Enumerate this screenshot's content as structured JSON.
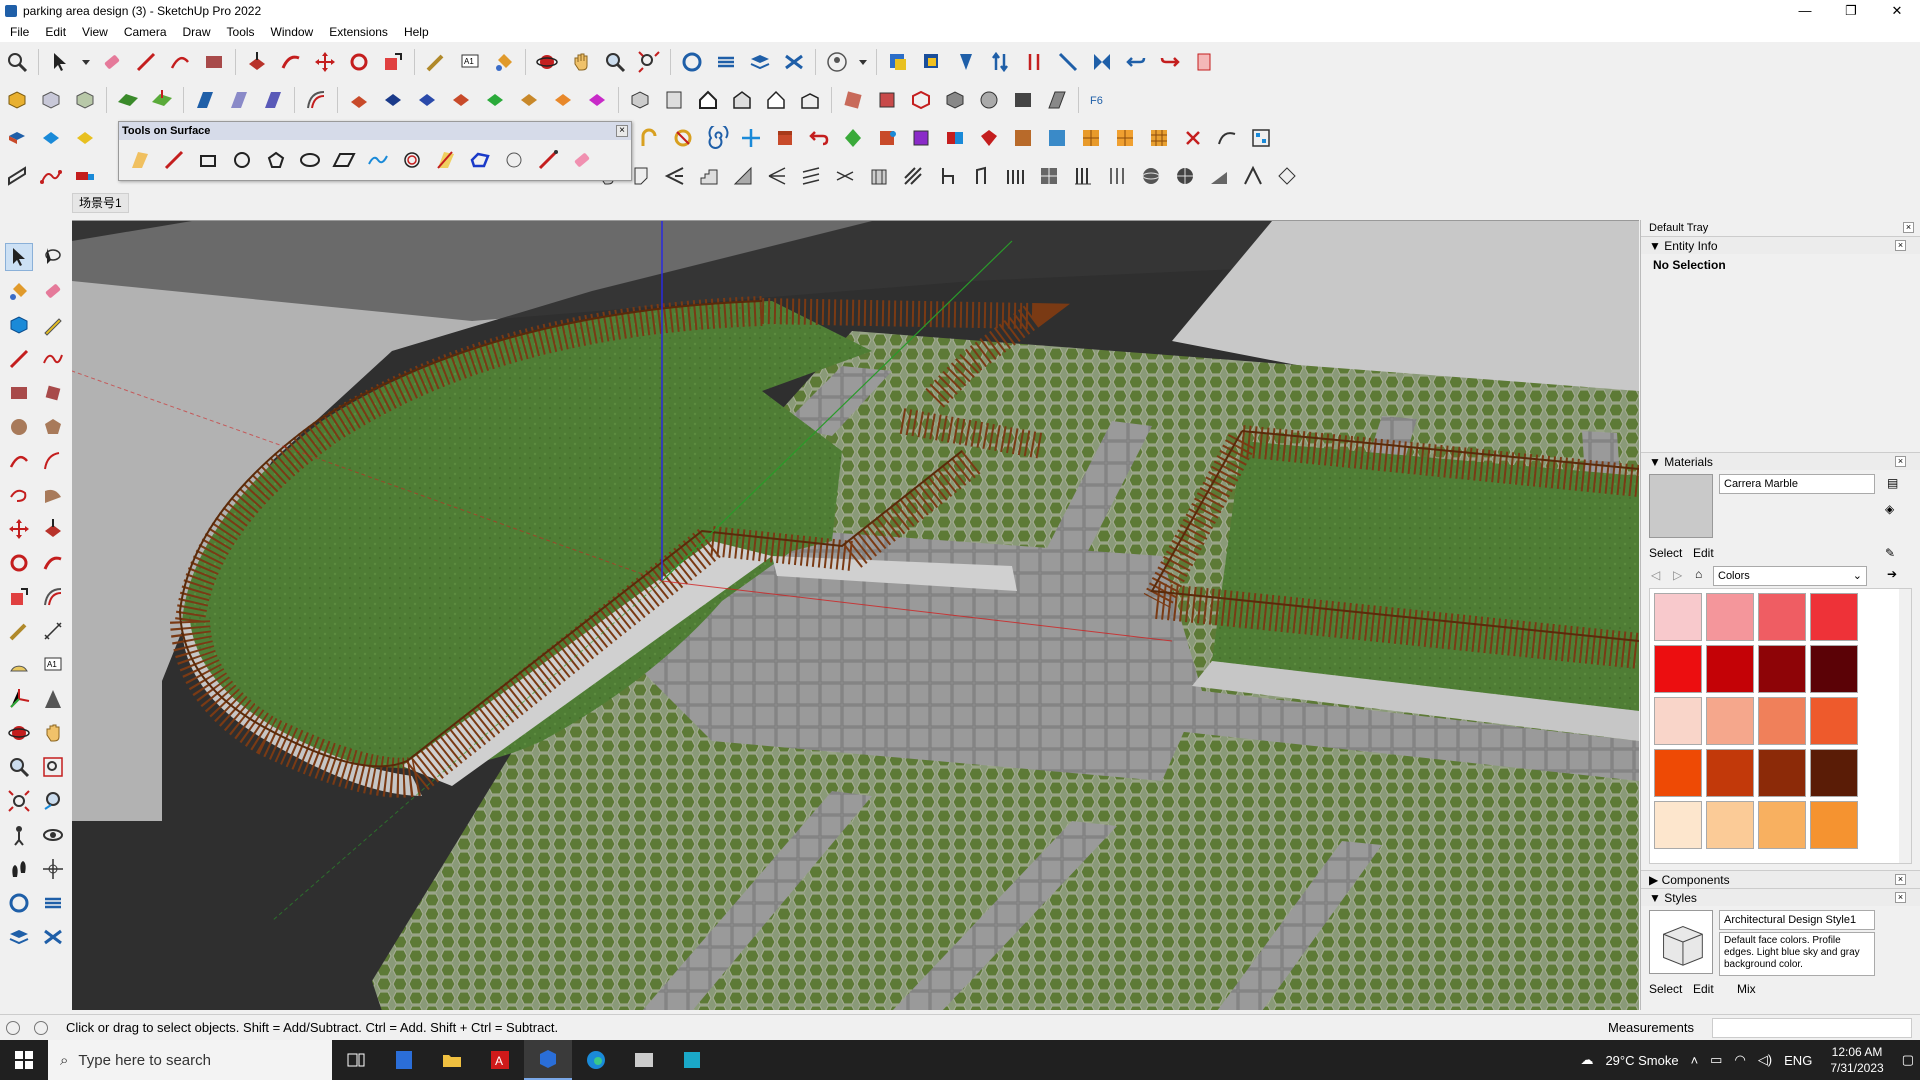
{
  "window": {
    "title": "parking area design (3) - SketchUp Pro 2022",
    "controls": [
      "—",
      "❐",
      "✕"
    ]
  },
  "menu": [
    "File",
    "Edit",
    "View",
    "Camera",
    "Draw",
    "Tools",
    "Window",
    "Extensions",
    "Help"
  ],
  "floating_toolbar": {
    "title": "Tools on Surface",
    "close": "×"
  },
  "scene_tab": "场景号1",
  "tray": {
    "title": "Default Tray",
    "entity_info": {
      "header": "Entity Info",
      "value": "No Selection"
    },
    "materials": {
      "header": "Materials",
      "name": "Carrera Marble",
      "tabs": [
        "Select",
        "Edit"
      ],
      "library": "Colors",
      "swatches": [
        "#f8c9cc",
        "#f4969b",
        "#ef5d63",
        "#ee3238",
        "#ec0e10",
        "#c40206",
        "#8e0407",
        "#5b0206",
        "#f9d5c9",
        "#f5a78c",
        "#f0805a",
        "#ee5a2c",
        "#ee4a05",
        "#c2390a",
        "#8c2a08",
        "#5a1c06",
        "#fde6cd",
        "#fbcb97",
        "#f8b060",
        "#f59330"
      ]
    },
    "components": {
      "header": "Components"
    },
    "styles": {
      "header": "Styles",
      "name": "Architectural Design Style1",
      "description": "Default face colors. Profile edges. Light blue sky and gray background color.",
      "tabs": [
        "Select",
        "Edit",
        "Mix"
      ]
    }
  },
  "status": {
    "message": "Click or drag to select objects. Shift = Add/Subtract. Ctrl = Add. Shift + Ctrl = Subtract.",
    "measurements_label": "Measurements"
  },
  "taskbar": {
    "search_placeholder": "Type here to search",
    "weather": "29°C  Smoke",
    "lang": "ENG",
    "time": "12:06 AM",
    "date": "7/31/2023"
  }
}
